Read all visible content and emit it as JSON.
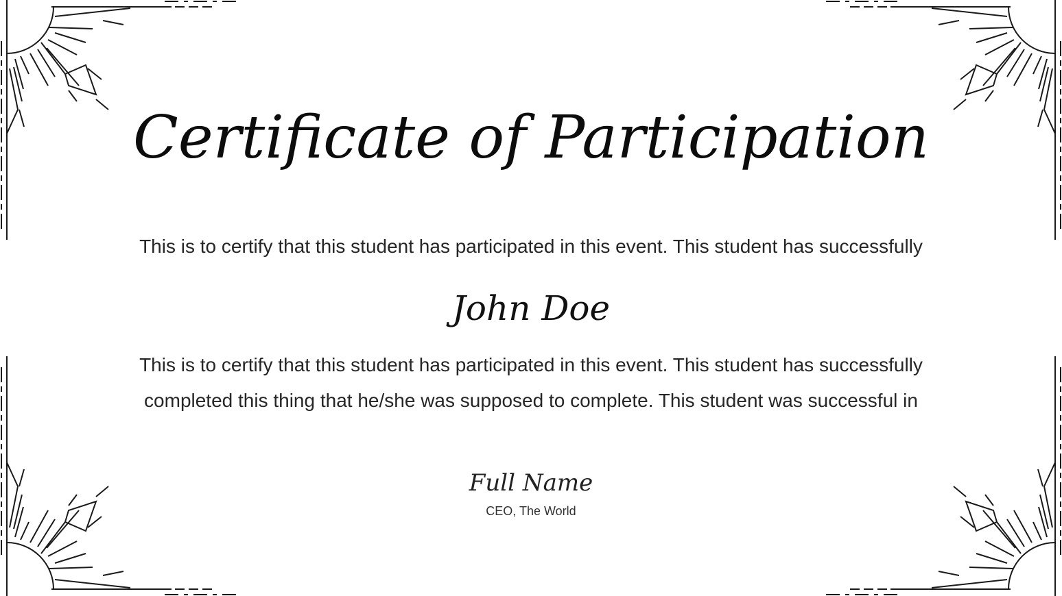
{
  "certificate": {
    "title": "Certificate of Participation",
    "intro_text": "This is to certify that this student has participated in this event. This student has successfully",
    "recipient_name": "John Doe",
    "details_line_1": "This is to certify that this student has participated in this event. This student has successfully",
    "details_line_2": "completed this thing that he/she was supposed to complete. This student was successful in",
    "signatory_name": "Full Name",
    "signatory_title": "CEO, The World"
  },
  "colors": {
    "background": "#ffffff",
    "ink": "#111111",
    "body_text": "#262626"
  },
  "decoration": {
    "corner_icon": "sunburst-corner-ornament"
  }
}
